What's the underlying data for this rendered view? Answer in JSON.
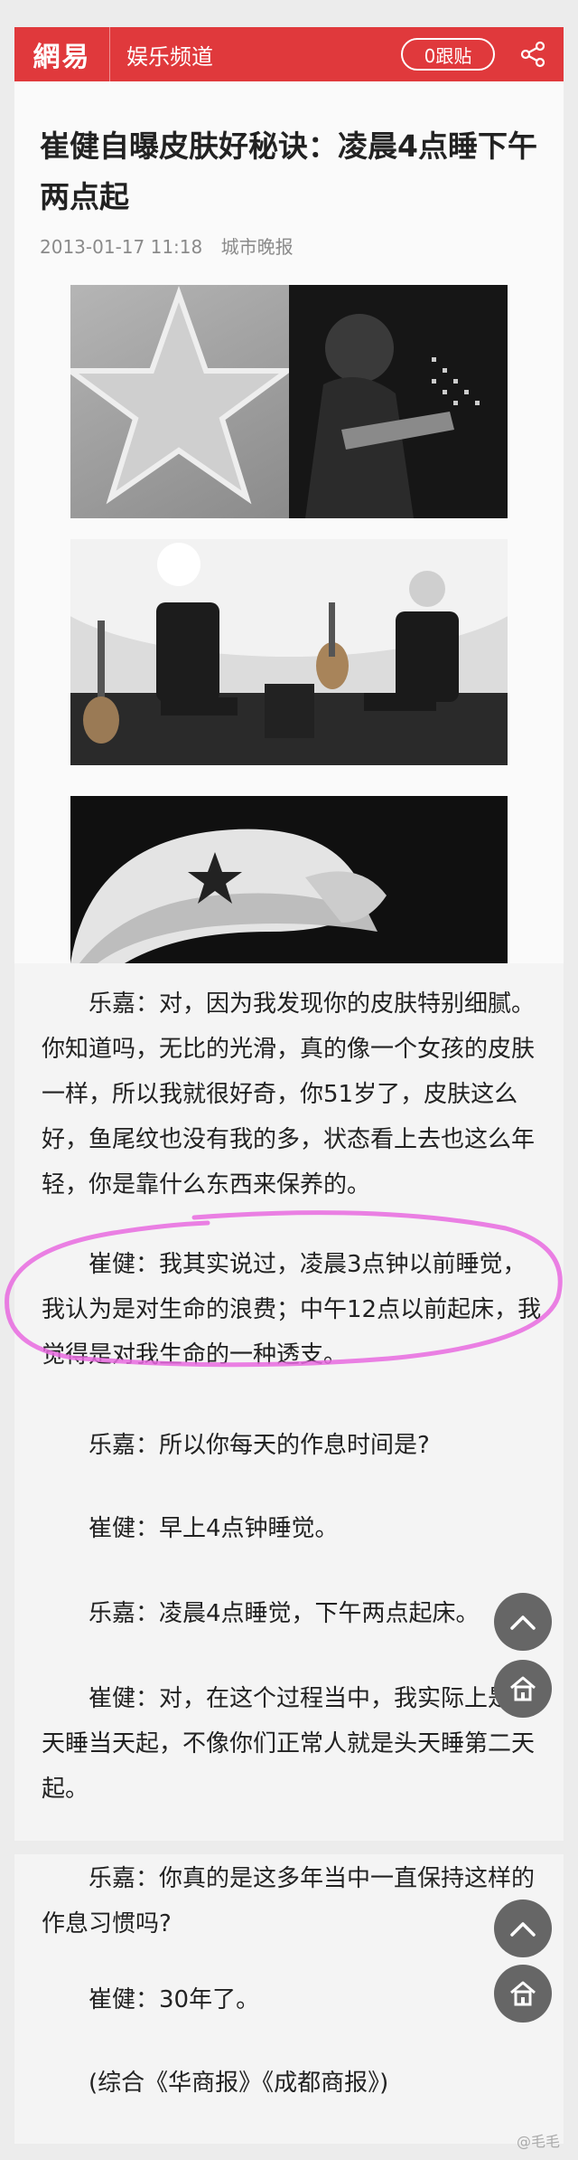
{
  "header": {
    "logo": "網易",
    "channel": "娱乐频道",
    "follow_label": "0跟贴",
    "share_icon": "share-icon"
  },
  "article": {
    "title": "崔健自曝皮肤好秘诀：凌晨4点睡下午两点起",
    "date": "2013-01-17 11:18",
    "source": "城市晚报"
  },
  "paragraphs": [
    "乐嘉：对，因为我发现你的皮肤特别细腻。你知道吗，无比的光滑，真的像一个女孩的皮肤一样，所以我就很好奇，你51岁了，皮肤这么好，鱼尾纹也没有我的多，状态看上去也这么年轻，你是靠什么东西来保养的。",
    "崔健：我其实说过，凌晨3点钟以前睡觉，我认为是对生命的浪费；中午12点以前起床，我觉得是对我生命的一种透支。",
    "乐嘉：所以你每天的作息时间是?",
    "崔健：早上4点钟睡觉。",
    "乐嘉：凌晨4点睡觉，下午两点起床。",
    "崔健：对，在这个过程当中，我实际上是当天睡当天起，不像你们正常人就是头天睡第二天起。",
    "乐嘉：你真的是这多年当中一直保持这样的作息习惯吗?",
    "崔健：30年了。",
    "(综合《华商报》《成都商报》)"
  ],
  "buttons": {
    "up_icon": "chevron-up-icon",
    "home_icon": "home-icon"
  },
  "watermark": "@毛毛",
  "colors": {
    "brand_red": "#e0393c",
    "highlight_pink": "#e86adf",
    "button_gray": "#666666"
  }
}
